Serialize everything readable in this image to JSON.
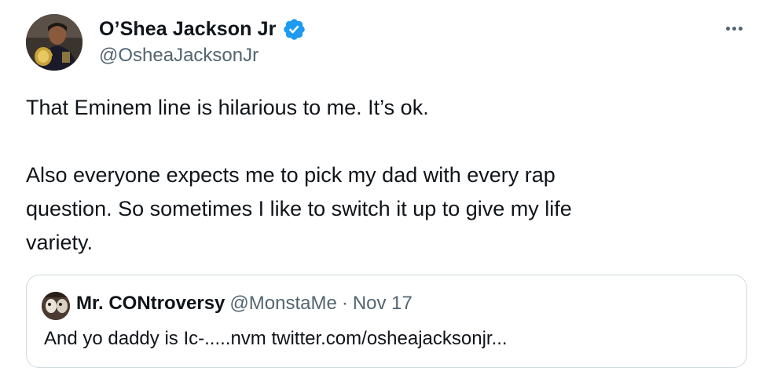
{
  "tweet": {
    "author": {
      "name": "O’Shea Jackson Jr",
      "handle": "@OsheaJacksonJr",
      "verified": true
    },
    "body": {
      "line1": "That Eminem line is hilarious to me. It’s ok.",
      "line2": "Also everyone expects me to pick my dad with every rap",
      "line3": "question. So sometimes I like to switch it up to give my life",
      "line4": "variety."
    },
    "quoted_tweet": {
      "name": "Mr. CONtroversy",
      "handle": "@MonstaMe",
      "separator": "·",
      "date": "Nov 17",
      "text": "And yo daddy is Ic-.....nvm twitter.com/osheajacksonjr..."
    }
  },
  "colors": {
    "text_primary": "#0f1419",
    "text_secondary": "#536471",
    "verified_blue": "#1d9bf0",
    "border": "#cfd9de"
  },
  "icons": {
    "verified": "verified-badge-icon",
    "more": "more-options-icon"
  }
}
